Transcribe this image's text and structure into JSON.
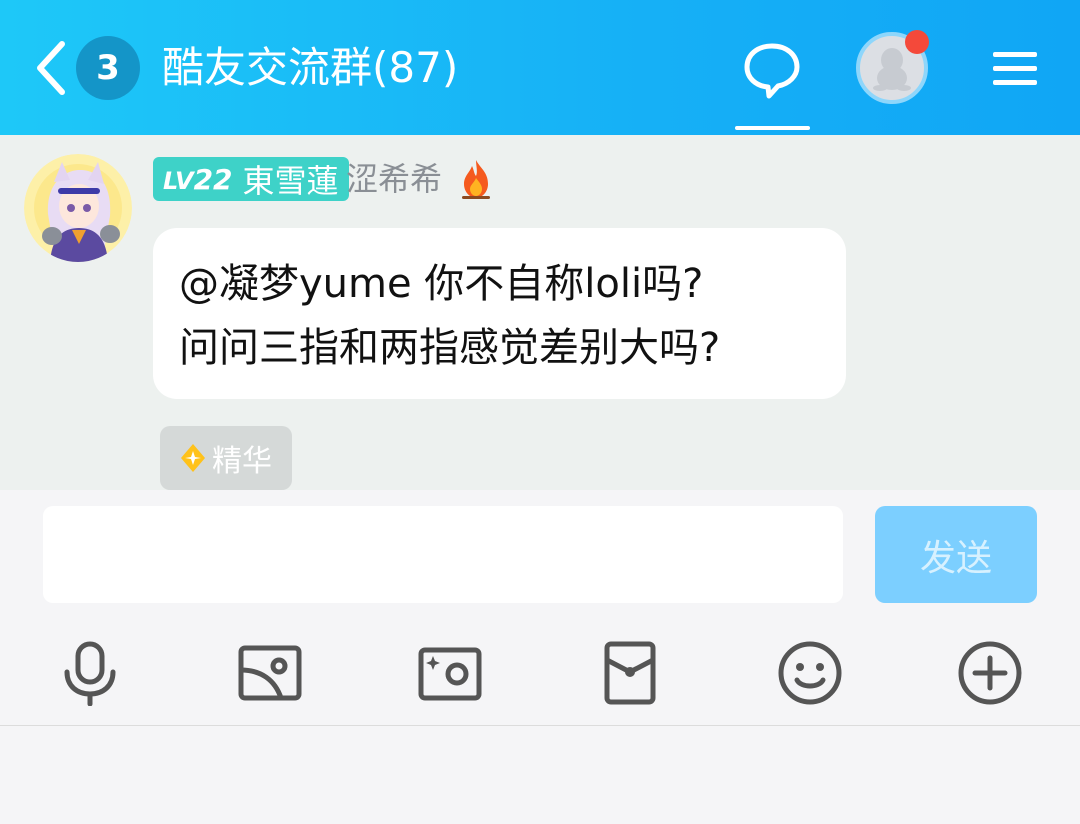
{
  "header": {
    "unread_count": "3",
    "title": "酷友交流群(87)"
  },
  "message": {
    "level_prefix": "LV",
    "level_number": "22",
    "title_tag": "東雪蓮",
    "sender_name": "涩希希",
    "lines": [
      "@凝梦yume 你不自称loli吗?",
      "问问三指和两指感觉差别大吗?"
    ],
    "essence_label": "精华"
  },
  "composer": {
    "input_value": "",
    "send_label": "发送"
  },
  "toolbar": {
    "icons": [
      "microphone-icon",
      "image-icon",
      "camera-icon",
      "red-packet-icon",
      "emoji-icon",
      "plus-icon"
    ]
  },
  "colors": {
    "header_gradient_start": "#1ec8f8",
    "header_gradient_end": "#10a6f5",
    "level_badge": "#3ed2c8",
    "send_button": "#7ccfff",
    "notification_dot": "#f4493a"
  }
}
